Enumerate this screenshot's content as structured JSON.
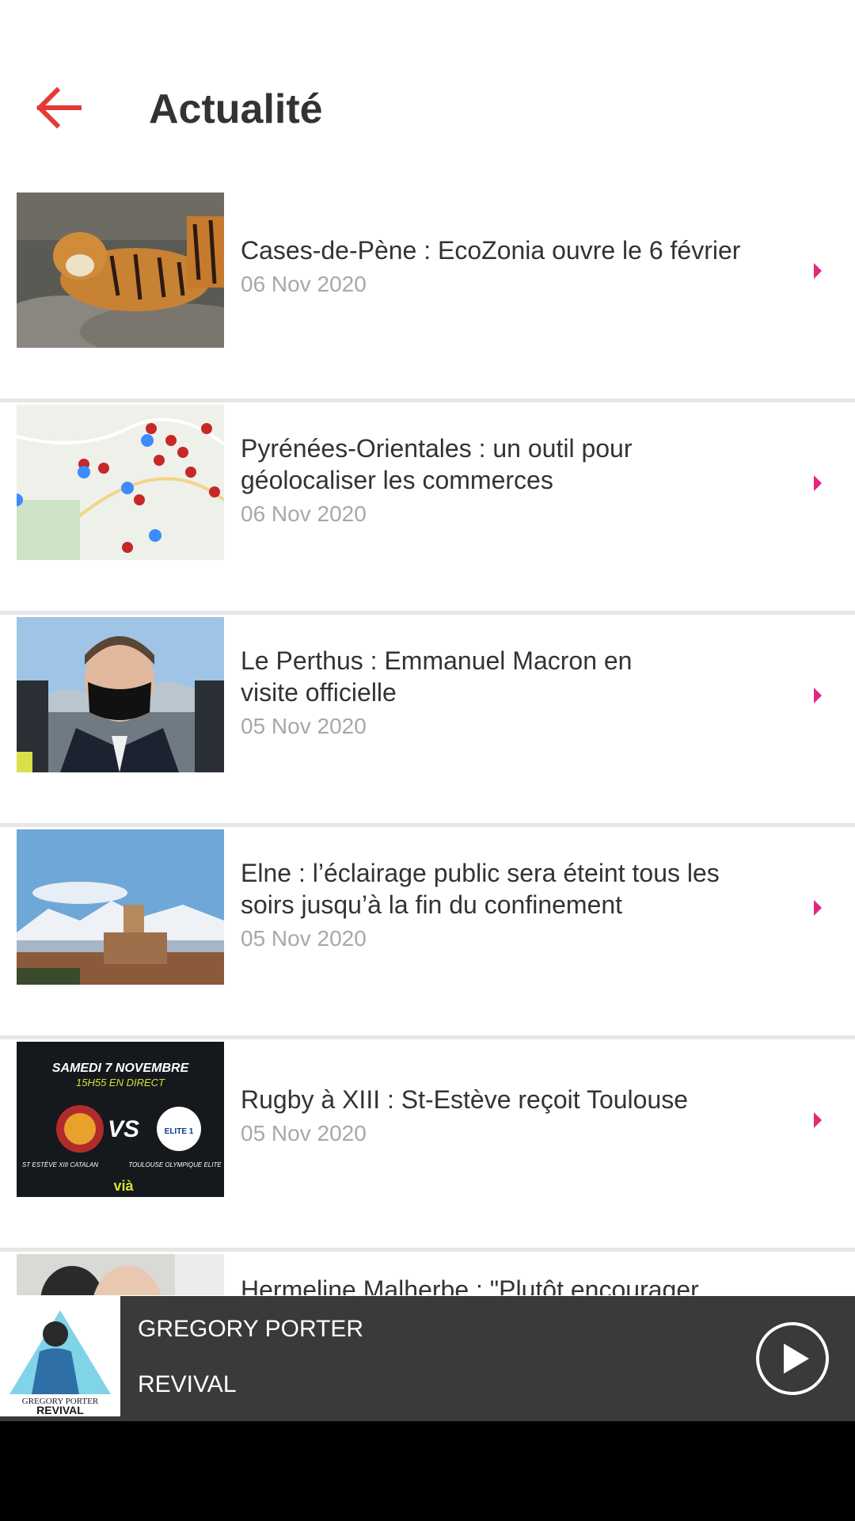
{
  "header": {
    "title": "Actualité",
    "back_icon": "arrow-left-icon",
    "accent_color": "#e53935"
  },
  "news": [
    {
      "title": "Cases-de-Pène : EcoZonia ouvre le 6 février",
      "date": "06 Nov 2020"
    },
    {
      "title": "Pyrénées-Orientales : un outil pour géolocaliser les commerces",
      "date": "06 Nov 2020"
    },
    {
      "title": "Le Perthus : Emmanuel Macron en visite officielle",
      "date": "05 Nov 2020"
    },
    {
      "title": "Elne : l’éclairage public sera éteint tous les soirs jusqu’à la fin du confinement",
      "date": "05 Nov 2020"
    },
    {
      "title": "Rugby à XIII : St-Estève reçoit Toulouse",
      "date": "05 Nov 2020",
      "thumb_text": {
        "line1": "SAMEDI 7 NOVEMBRE",
        "line2": "15H55 EN DIRECT",
        "vs": "VS",
        "left_team": "ST ESTÈVE XIII CATALAN",
        "right_team": "TOULOUSE OLYMPIQUE ELITE",
        "logo": "vià",
        "badge": "ELITE 1"
      }
    },
    {
      "title": "Hermeline Malherbe : \"Plutôt encourager",
      "date": ""
    }
  ],
  "player": {
    "artist": "GREGORY PORTER",
    "track": "REVIVAL",
    "cover_text_1": "GREGORY PORTER",
    "cover_text_2": "REVIVAL",
    "play_icon": "play-icon"
  },
  "colors": {
    "chevron": "#e5267f",
    "player_bg": "#3a3a3a",
    "divider": "#e6e6e6"
  }
}
